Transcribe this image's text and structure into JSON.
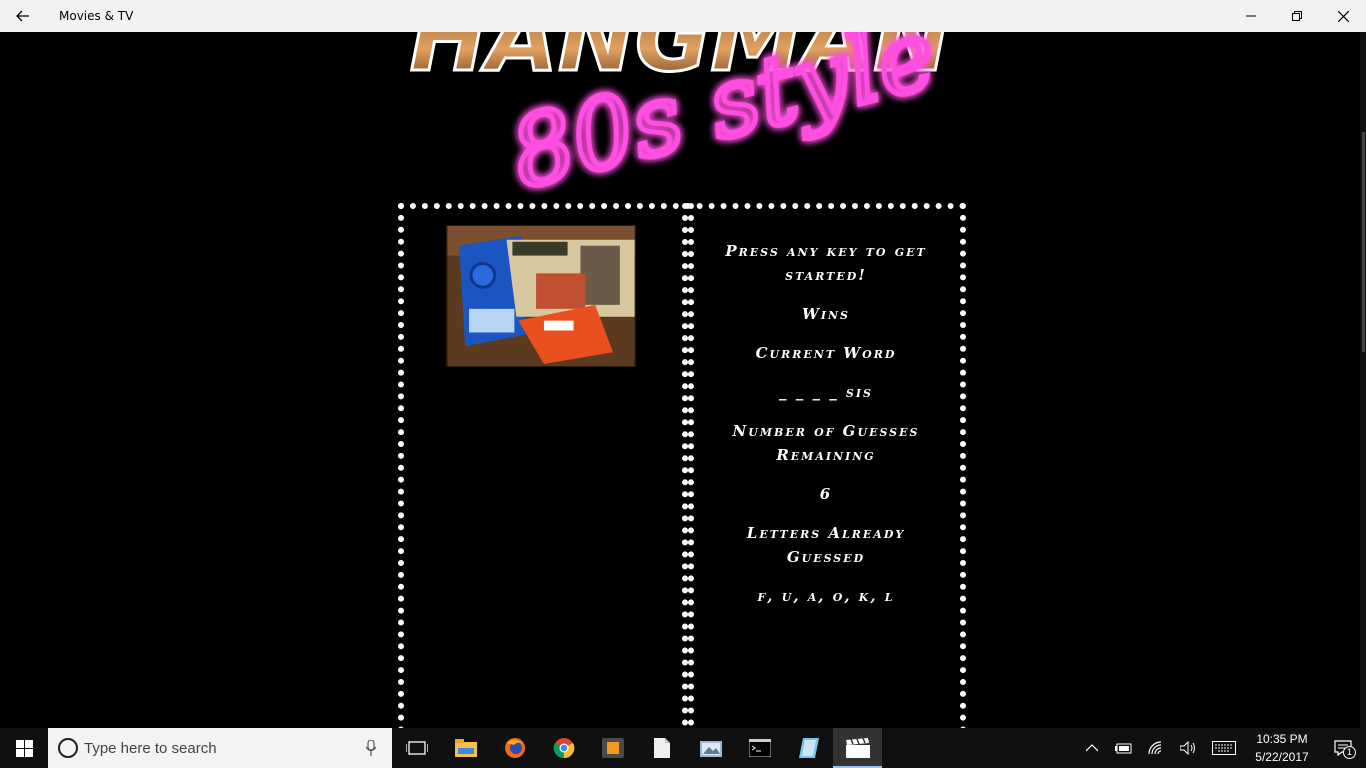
{
  "window": {
    "title": "Movies & TV"
  },
  "game": {
    "logo_text": "HANGMAN",
    "logo_sub": "80s style",
    "prompt": "Press any key to get started!",
    "wins_label": "Wins",
    "current_word_label": "Current Word",
    "current_word": "_ _ _ _ sis",
    "guesses_label": "Number of Guesses Remaining",
    "guesses_remaining": "6",
    "letters_label": "Letters Already Guessed",
    "letters_guessed": "f, u, a, o, k, l"
  },
  "taskbar": {
    "search_placeholder": "Type here to search",
    "time": "10:35 PM",
    "date": "5/22/2017",
    "notification_count": "1"
  }
}
